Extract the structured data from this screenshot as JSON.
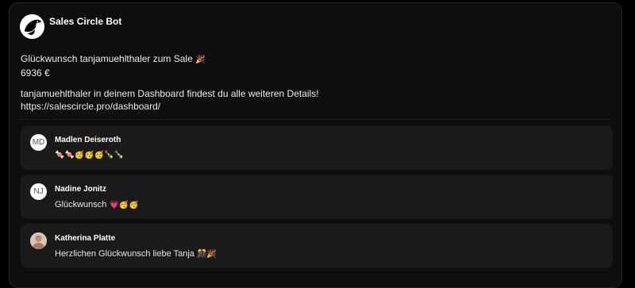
{
  "post": {
    "author": "Sales Circle Bot",
    "line1_prefix": "Glückwunsch tanjamuehlthaler zum Sale",
    "line1_emoji": "🎉",
    "amount": "6936 €",
    "line3": "tanjamuehlthaler in deinem Dashboard findest du alle weiteren Details!",
    "link": "https://salescircle.pro/dashboard/"
  },
  "comments": [
    {
      "initials": "MD",
      "name": "Madlen Deiseroth",
      "text": "🍬🍬🥳🥳🥳🍾🍾"
    },
    {
      "initials": "NJ",
      "name": "Nadine Jonitz",
      "text_prefix": "Glückwunsch",
      "emoji": "💗🥳🥳"
    },
    {
      "initials": "",
      "name": "Katherina Platte",
      "text_prefix": "Herzlichen Glückwunsch liebe Tanja",
      "emoji": "🎊🎉"
    }
  ],
  "colors": {
    "background": "#000000",
    "card": "#0e0e0e",
    "comment": "#1a1a1a",
    "text": "#ececec"
  }
}
